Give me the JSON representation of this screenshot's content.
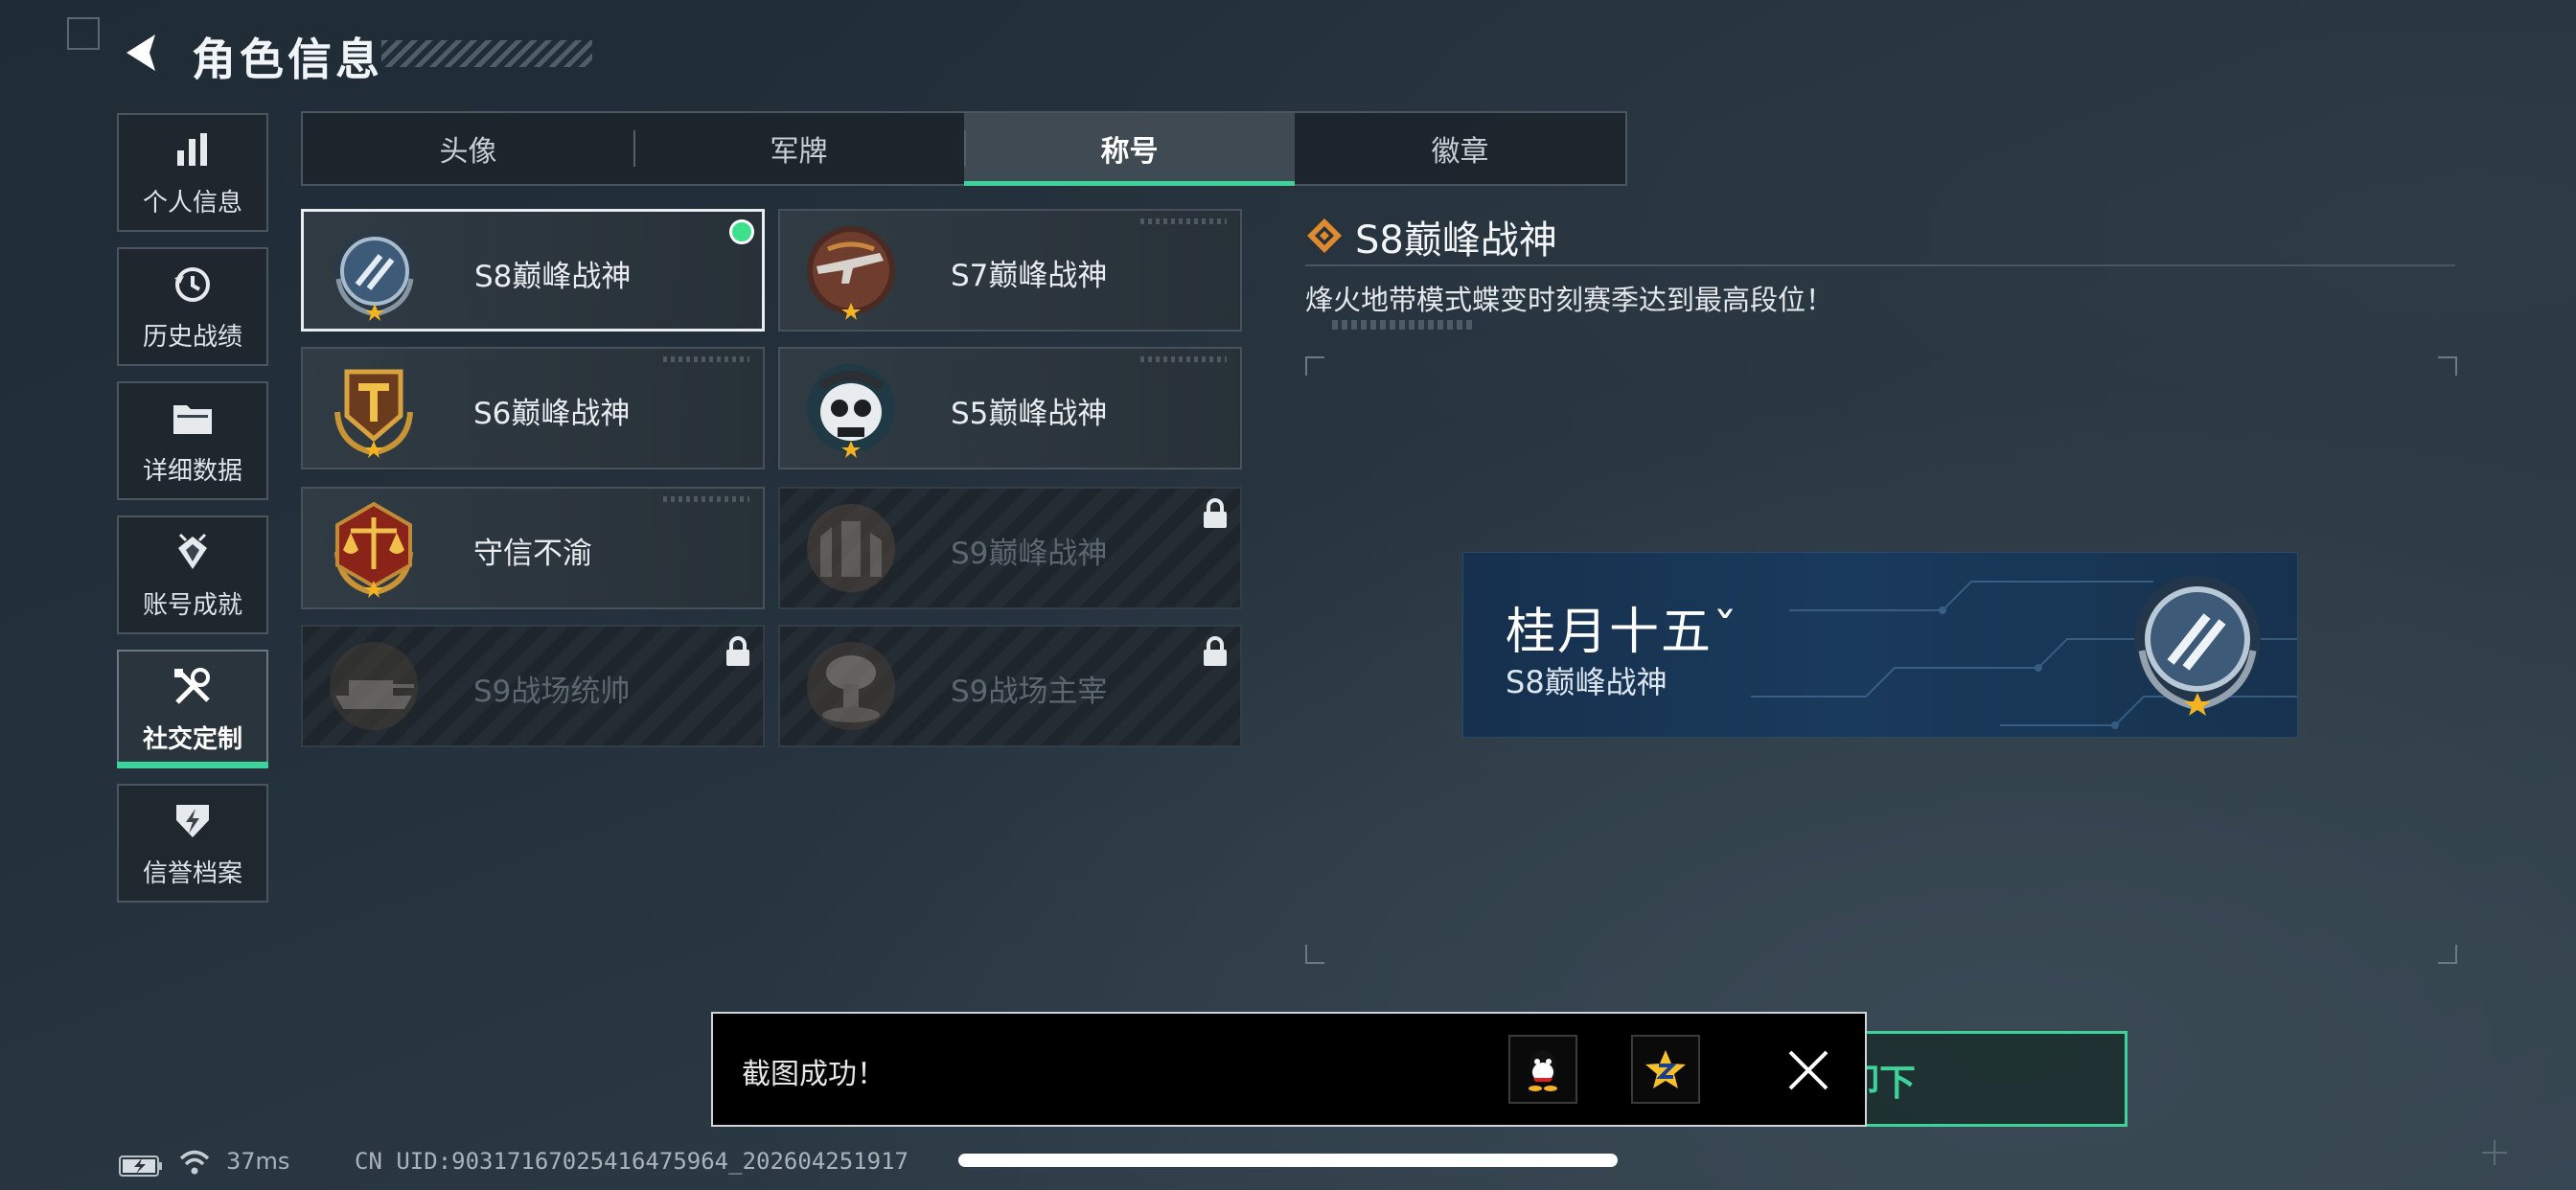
{
  "header": {
    "title": "角色信息"
  },
  "sidebar": {
    "items": [
      {
        "label": "个人信息",
        "icon": "bar-chart-icon"
      },
      {
        "label": "历史战绩",
        "icon": "history-clock-icon"
      },
      {
        "label": "详细数据",
        "icon": "folder-icon"
      },
      {
        "label": "账号成就",
        "icon": "achievement-icon"
      },
      {
        "label": "社交定制",
        "icon": "tools-icon",
        "active": true
      },
      {
        "label": "信誉档案",
        "icon": "credit-icon"
      }
    ]
  },
  "tabs": [
    {
      "label": "头像"
    },
    {
      "label": "军牌"
    },
    {
      "label": "称号",
      "active": true
    },
    {
      "label": "徽章"
    }
  ],
  "titles": [
    {
      "name": "S8巅峰战神",
      "emblem": "blue-laurel-emblem-icon",
      "selected": true,
      "equipped": true,
      "locked": false
    },
    {
      "name": "S7巅峰战神",
      "emblem": "rifle-emblem-icon",
      "locked": false
    },
    {
      "name": "S6巅峰战神",
      "emblem": "gold-t-emblem-icon",
      "locked": false
    },
    {
      "name": "S5巅峰战神",
      "emblem": "skull-emblem-icon",
      "locked": false
    },
    {
      "name": "守信不渝",
      "emblem": "scales-emblem-icon",
      "locked": false
    },
    {
      "name": "S9巅峰战神",
      "emblem": "ruins-emblem-icon",
      "locked": true
    },
    {
      "name": "S9战场统帅",
      "emblem": "tank-emblem-icon",
      "locked": true
    },
    {
      "name": "S9战场主宰",
      "emblem": "mushroom-cloud-emblem-icon",
      "locked": true
    }
  ],
  "detail": {
    "title": "S8巅峰战神",
    "description": "烽火地带模式蝶变时刻赛季达到最高段位！",
    "preview": {
      "player_name": "桂月十五ˇ",
      "title": "S8巅峰战神"
    }
  },
  "confirm_button": {
    "label_visible": "卸下"
  },
  "toast": {
    "message": "截图成功！"
  },
  "status": {
    "ping": "37ms",
    "uid": "CN UID:9031716702541647596​4_202604251917"
  },
  "colors": {
    "accent": "#3ed39a",
    "equipped_dot": "#3ee08e",
    "banner_blue": "#1a3a5c"
  }
}
